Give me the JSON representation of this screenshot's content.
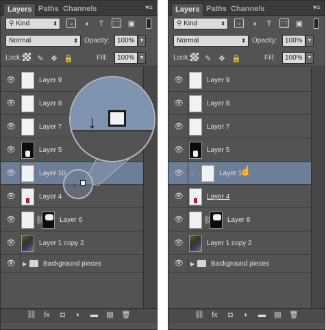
{
  "tabs": [
    "Layers",
    "Paths",
    "Channels"
  ],
  "filter": {
    "kind_label": "Kind"
  },
  "blend_mode": "Normal",
  "opacity": {
    "label": "Opacity:",
    "value": "100%"
  },
  "lock": {
    "label": "Lock:"
  },
  "fill": {
    "label": "Fill:",
    "value": "100%"
  },
  "left_panel": {
    "layers": [
      {
        "name": "Layer 9"
      },
      {
        "name": "Layer 8"
      },
      {
        "name": "Layer 7"
      },
      {
        "name": "Layer 5"
      },
      {
        "name": "Layer 10"
      },
      {
        "name": "Layer 4"
      },
      {
        "name": "Layer 6"
      },
      {
        "name": "Layer 1 copy 2"
      },
      {
        "name": "Background pieces"
      }
    ]
  },
  "right_panel": {
    "layers": [
      {
        "name": "Layer 9"
      },
      {
        "name": "Layer 8"
      },
      {
        "name": "Layer 7"
      },
      {
        "name": "Layer 5"
      },
      {
        "name": "Layer 10"
      },
      {
        "name": "Layer 4"
      },
      {
        "name": "Layer 6"
      },
      {
        "name": "Layer 1 copy 2"
      },
      {
        "name": "Background pieces"
      }
    ]
  },
  "colors": {
    "panel_bg": "#535353",
    "selected_row": "#6c7e98",
    "tab_bar": "#3a3a3a"
  }
}
